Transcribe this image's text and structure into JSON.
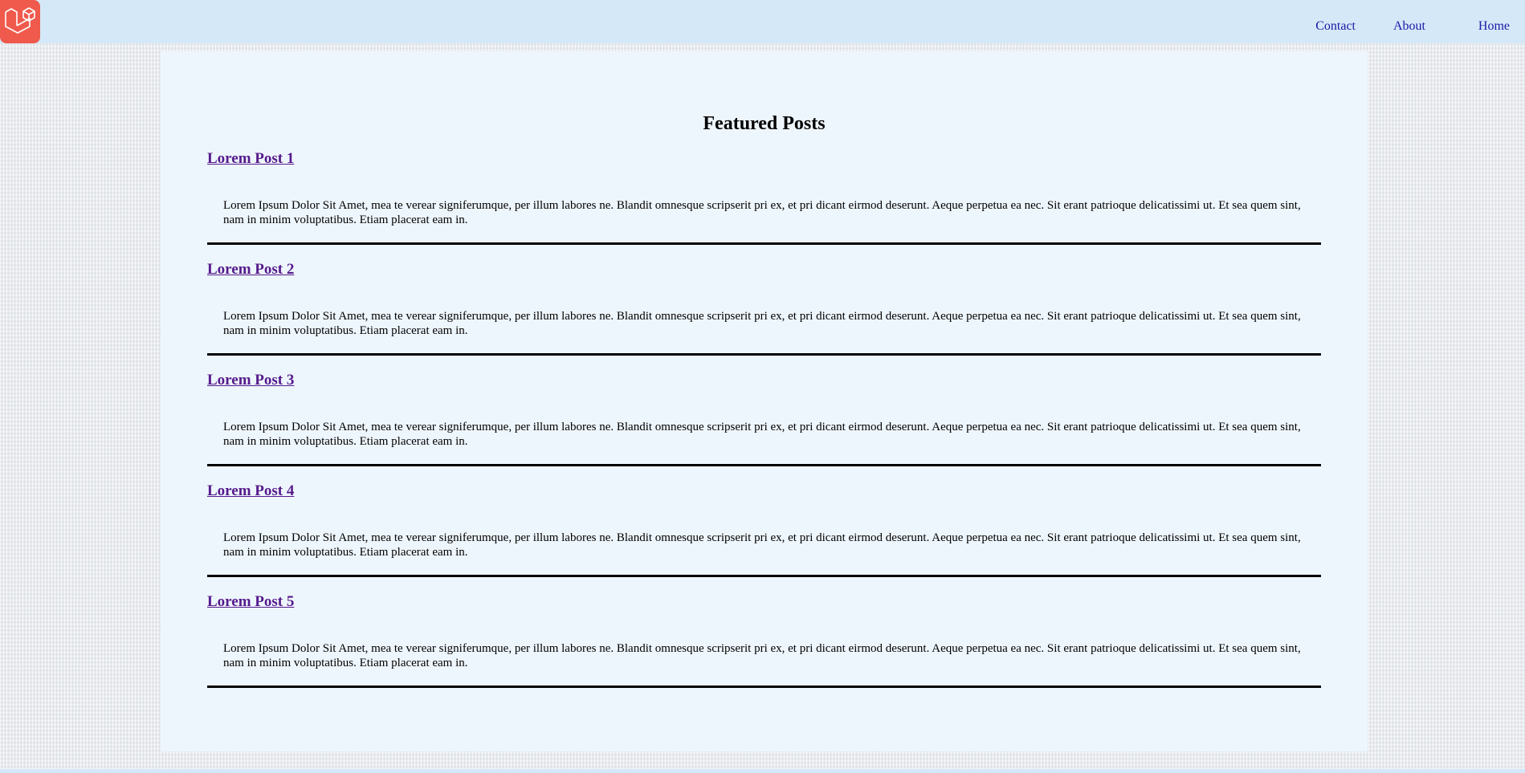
{
  "nav": {
    "contact": "Contact",
    "about": "About",
    "home": "Home"
  },
  "main": {
    "title": "Featured Posts",
    "posts": [
      {
        "title": "Lorem Post 1",
        "body": "Lorem Ipsum Dolor Sit Amet, mea te verear signiferumque, per illum labores ne. Blandit omnesque scripserit pri ex, et pri dicant eirmod deserunt. Aeque perpetua ea nec. Sit erant patrioque delicatissimi ut. Et sea quem sint, nam in minim voluptatibus. Etiam placerat eam in."
      },
      {
        "title": "Lorem Post 2",
        "body": "Lorem Ipsum Dolor Sit Amet, mea te verear signiferumque, per illum labores ne. Blandit omnesque scripserit pri ex, et pri dicant eirmod deserunt. Aeque perpetua ea nec. Sit erant patrioque delicatissimi ut. Et sea quem sint, nam in minim voluptatibus. Etiam placerat eam in."
      },
      {
        "title": "Lorem Post 3",
        "body": "Lorem Ipsum Dolor Sit Amet, mea te verear signiferumque, per illum labores ne. Blandit omnesque scripserit pri ex, et pri dicant eirmod deserunt. Aeque perpetua ea nec. Sit erant patrioque delicatissimi ut. Et sea quem sint, nam in minim voluptatibus. Etiam placerat eam in."
      },
      {
        "title": "Lorem Post 4",
        "body": "Lorem Ipsum Dolor Sit Amet, mea te verear signiferumque, per illum labores ne. Blandit omnesque scripserit pri ex, et pri dicant eirmod deserunt. Aeque perpetua ea nec. Sit erant patrioque delicatissimi ut. Et sea quem sint, nam in minim voluptatibus. Etiam placerat eam in."
      },
      {
        "title": "Lorem Post 5",
        "body": "Lorem Ipsum Dolor Sit Amet, mea te verear signiferumque, per illum labores ne. Blandit omnesque scripserit pri ex, et pri dicant eirmod deserunt. Aeque perpetua ea nec. Sit erant patrioque delicatissimi ut. Et sea quem sint, nam in minim voluptatibus. Etiam placerat eam in."
      }
    ]
  },
  "logo": {
    "icon": "laravel-logo-icon"
  },
  "colors": {
    "header_bg": "#d4e8f8",
    "panel_bg": "#eef6fd",
    "logo_red": "#ef5a4c",
    "nav_link": "#1a1aa6",
    "visited_link": "#551a8b"
  }
}
